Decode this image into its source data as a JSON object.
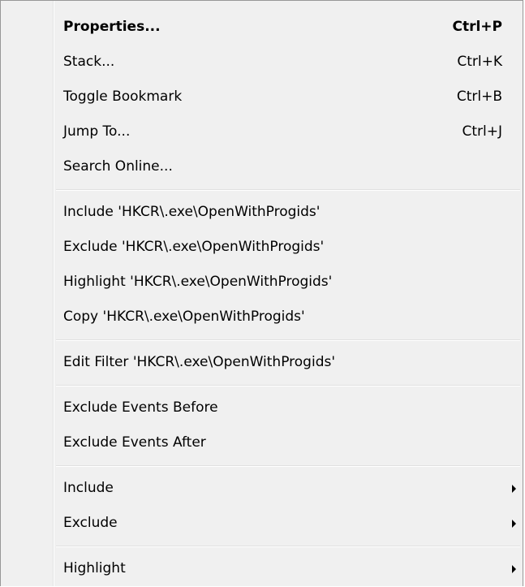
{
  "menu": {
    "groups": [
      [
        {
          "label": "Properties...",
          "shortcut": "Ctrl+P",
          "bold": true
        },
        {
          "label": "Stack...",
          "shortcut": "Ctrl+K"
        },
        {
          "label": "Toggle Bookmark",
          "shortcut": "Ctrl+B"
        },
        {
          "label": "Jump To...",
          "shortcut": "Ctrl+J"
        },
        {
          "label": "Search Online...",
          "shortcut": ""
        }
      ],
      [
        {
          "label": "Include 'HKCR\\.exe\\OpenWithProgids'"
        },
        {
          "label": "Exclude 'HKCR\\.exe\\OpenWithProgids'"
        },
        {
          "label": "Highlight 'HKCR\\.exe\\OpenWithProgids'"
        },
        {
          "label": "Copy 'HKCR\\.exe\\OpenWithProgids'"
        }
      ],
      [
        {
          "label": "Edit Filter 'HKCR\\.exe\\OpenWithProgids'"
        }
      ],
      [
        {
          "label": "Exclude Events Before"
        },
        {
          "label": "Exclude Events After"
        }
      ],
      [
        {
          "label": "Include",
          "submenu": true,
          "arrow_icon": "submenu-arrow-icon"
        },
        {
          "label": "Exclude",
          "submenu": true,
          "arrow_icon": "submenu-arrow-icon"
        }
      ],
      [
        {
          "label": "Highlight",
          "submenu": true,
          "arrow_icon": "submenu-arrow-icon"
        }
      ]
    ]
  }
}
